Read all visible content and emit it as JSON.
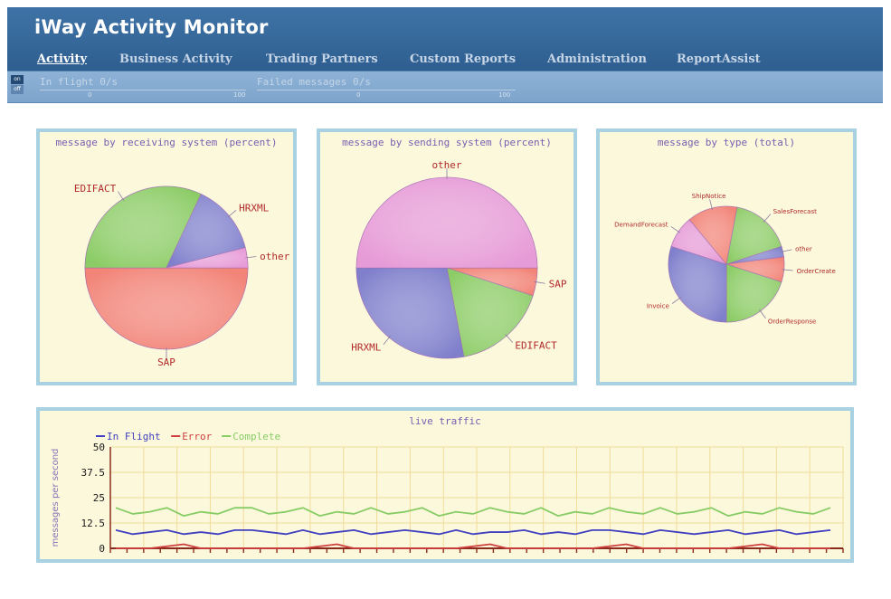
{
  "app": {
    "title": "iWay Activity Monitor"
  },
  "nav": {
    "items": [
      {
        "label": "Activity",
        "active": true
      },
      {
        "label": "Business Activity",
        "active": false
      },
      {
        "label": "Trading Partners",
        "active": false
      },
      {
        "label": "Custom Reports",
        "active": false
      },
      {
        "label": "Administration",
        "active": false
      },
      {
        "label": "ReportAssist",
        "active": false
      }
    ]
  },
  "status": {
    "toggle_on": "on",
    "toggle_off": "off",
    "in_flight": {
      "label": "In flight  0/s",
      "min": "0",
      "max": "100"
    },
    "failed": {
      "label": "Failed messages  0/s",
      "min": "0",
      "max": "100"
    }
  },
  "colors": {
    "pie_green": "#8ccc66",
    "pie_blue": "#7f7fcc",
    "pie_pink": "#e69ad6",
    "pie_red": "#f28478",
    "line_inflight": "#4040c0",
    "line_error": "#d04040",
    "line_complete": "#88cc66"
  },
  "panels": {
    "receiving": {
      "title": "message by receiving system (percent)",
      "chart_data": {
        "type": "pie",
        "title": "message by receiving system (percent)",
        "slices": [
          {
            "label": "SAP",
            "value": 50,
            "color": "#f28478"
          },
          {
            "label": "EDIFACT",
            "value": 32,
            "color": "#8ccc66"
          },
          {
            "label": "HRXML",
            "value": 14,
            "color": "#7f7fcc"
          },
          {
            "label": "other",
            "value": 4,
            "color": "#e69ad6"
          }
        ]
      }
    },
    "sending": {
      "title": "message by sending system (percent)",
      "chart_data": {
        "type": "pie",
        "title": "message by sending system (percent)",
        "slices": [
          {
            "label": "SAP",
            "value": 5,
            "color": "#f28478"
          },
          {
            "label": "EDIFACT",
            "value": 17,
            "color": "#8ccc66"
          },
          {
            "label": "HRXML",
            "value": 28,
            "color": "#7f7fcc"
          },
          {
            "label": "other",
            "value": 50,
            "color": "#e69ad6"
          }
        ]
      }
    },
    "type": {
      "title": "message by type (total)",
      "chart_data": {
        "type": "pie",
        "title": "message by type (total)",
        "slices": [
          {
            "label": "other",
            "value": 3,
            "color": "#7f7fcc"
          },
          {
            "label": "OrderCreate",
            "value": 7,
            "color": "#f28478"
          },
          {
            "label": "OrderResponse",
            "value": 20,
            "color": "#8ccc66"
          },
          {
            "label": "Invoice",
            "value": 30,
            "color": "#7f7fcc"
          },
          {
            "label": "DemandForecast",
            "value": 9,
            "color": "#e69ad6"
          },
          {
            "label": "ShipNotice",
            "value": 14,
            "color": "#f28478"
          },
          {
            "label": "SalesForecast",
            "value": 17,
            "color": "#8ccc66"
          }
        ]
      }
    },
    "traffic": {
      "title": "live traffic",
      "chart_data": {
        "type": "line",
        "title": "live traffic",
        "ylabel": "messages per second",
        "ylim": [
          0,
          50
        ],
        "yticks": [
          "0",
          "12.5",
          "25",
          "37.5",
          "50"
        ],
        "series": [
          {
            "name": "In Flight",
            "color": "#4040c0",
            "values": [
              9,
              7,
              8,
              9,
              7,
              8,
              7,
              9,
              9,
              8,
              7,
              9,
              7,
              8,
              9,
              7,
              8,
              9,
              8,
              7,
              9,
              7,
              8,
              8,
              9,
              7,
              8,
              7,
              9,
              9,
              8,
              7,
              9,
              8,
              7,
              8,
              9,
              7,
              8,
              9,
              7,
              8,
              9
            ]
          },
          {
            "name": "Error",
            "color": "#d04040",
            "values": [
              0,
              0,
              0,
              1,
              2,
              0,
              0,
              0,
              0,
              0,
              0,
              0,
              1,
              2,
              0,
              0,
              0,
              0,
              0,
              0,
              0,
              1,
              2,
              0,
              0,
              0,
              0,
              0,
              0,
              1,
              2,
              0,
              0,
              0,
              0,
              0,
              0,
              1,
              2,
              0,
              0,
              0,
              0
            ]
          },
          {
            "name": "Complete",
            "color": "#88cc66",
            "values": [
              20,
              17,
              18,
              20,
              16,
              18,
              17,
              20,
              20,
              17,
              18,
              20,
              16,
              18,
              17,
              20,
              17,
              18,
              20,
              16,
              18,
              17,
              20,
              18,
              17,
              20,
              16,
              18,
              17,
              20,
              18,
              17,
              20,
              17,
              18,
              20,
              16,
              18,
              17,
              20,
              18,
              17,
              20
            ]
          }
        ]
      }
    }
  }
}
